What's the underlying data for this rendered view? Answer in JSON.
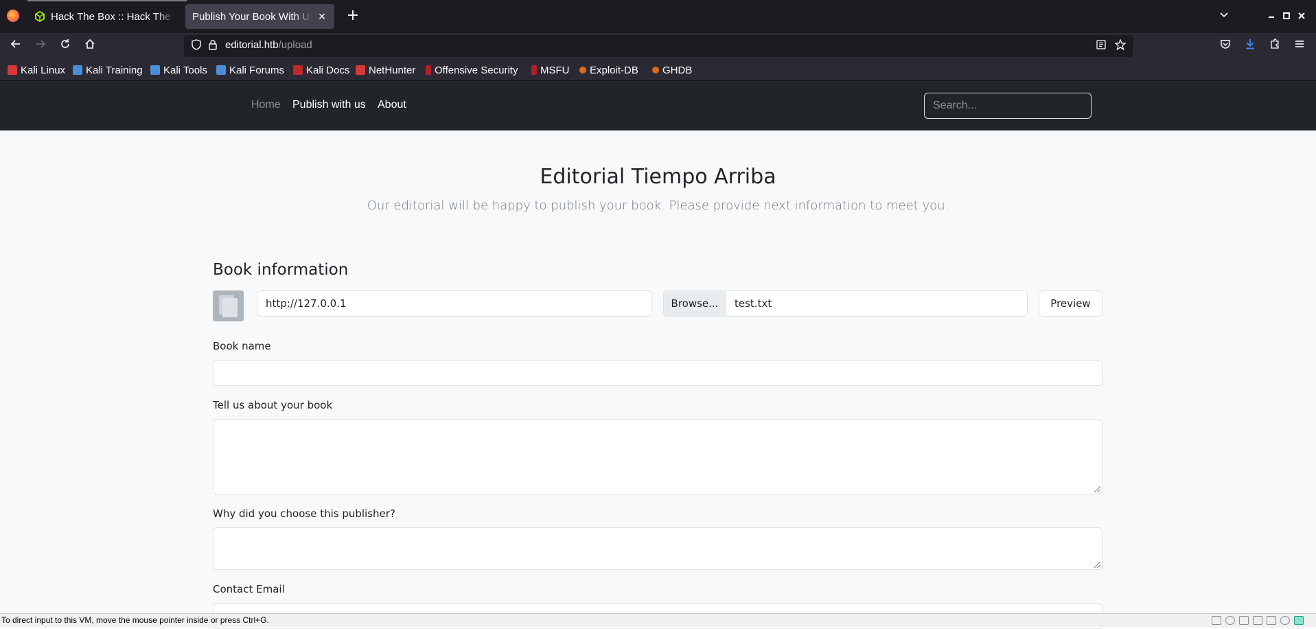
{
  "browser": {
    "tabs": [
      {
        "title": "Hack The Box :: Hack The Box",
        "close": "✕"
      },
      {
        "title": "Publish Your Book With Us - Editorial Tiempo Arriba",
        "close": "✕"
      }
    ],
    "new_tab": "+",
    "url_host": "editorial.htb",
    "url_path": "/upload",
    "bookmarks": [
      {
        "label": "Kali Linux",
        "color": "#d8383a"
      },
      {
        "label": "Kali Training",
        "color": "#4a8ed8"
      },
      {
        "label": "Kali Tools",
        "color": "#4a8ed8"
      },
      {
        "label": "Kali Forums",
        "color": "#4a8ed8"
      },
      {
        "label": "Kali Docs",
        "color": "#c0282a"
      },
      {
        "label": "NetHunter",
        "color": "#d8383a"
      },
      {
        "label": "Offensive Security",
        "color": "#b0202a"
      },
      {
        "label": "MSFU",
        "color": "#b0202a"
      },
      {
        "label": "Exploit-DB",
        "color": "#e06a20"
      },
      {
        "label": "GHDB",
        "color": "#e06a20"
      }
    ]
  },
  "site_nav": {
    "links": [
      "Home",
      "Publish with us",
      "About"
    ],
    "search_placeholder": "Search..."
  },
  "hero": {
    "title": "Editorial Tiempo Arriba",
    "subtitle": "Our editorial will be happy to publish your book. Please provide next information to meet you."
  },
  "form": {
    "heading": "Book information",
    "cover_url_value": "http://127.0.0.1",
    "browse_label": "Browse...",
    "file_name": "test.txt",
    "preview_label": "Preview",
    "book_name_label": "Book name",
    "about_label": "Tell us about your book",
    "why_label": "Why did you choose this publisher?",
    "email_label": "Contact Email"
  },
  "vm_status": "To direct input to this VM, move the mouse pointer inside or press Ctrl+G."
}
